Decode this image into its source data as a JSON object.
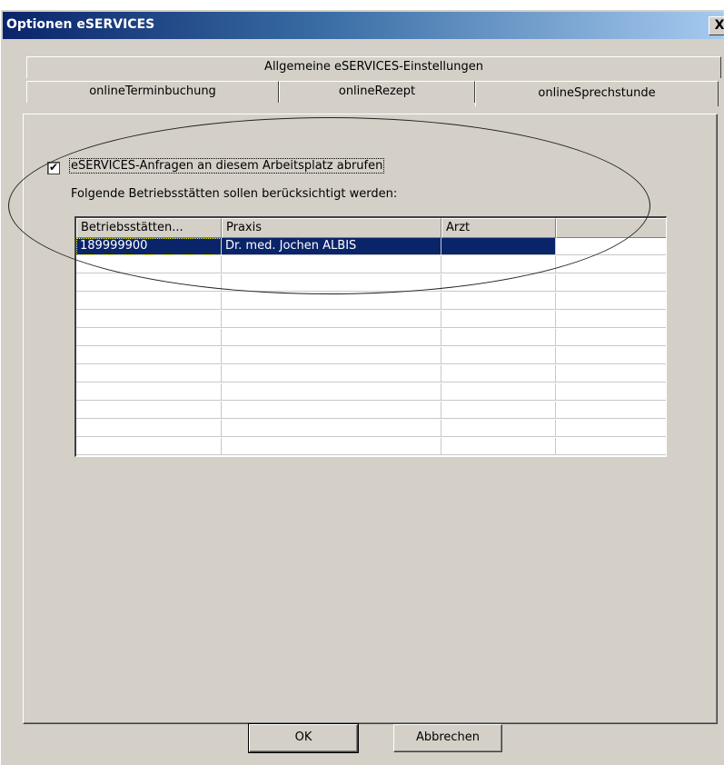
{
  "dialog": {
    "title": "Optionen eSERVICES",
    "close_label": "X"
  },
  "tabs": {
    "row_top": [
      {
        "label": "Allgemeine eSERVICES-Einstellungen"
      }
    ],
    "row_bottom": [
      {
        "label": "onlineTerminbuchung"
      },
      {
        "label": "onlineRezept"
      },
      {
        "label": "onlineSprechstunde",
        "active": true
      }
    ]
  },
  "panel": {
    "checkbox_checked": true,
    "checkbox_mark": "✔",
    "checkbox_label": "eSERVICES-Anfragen an diesem Arbeitsplatz abrufen",
    "sub_label": "Folgende  Betriebsstätten sollen berücksichtigt werden:"
  },
  "grid": {
    "columns": [
      "Betriebsstätten...",
      "Praxis",
      "Arzt",
      ""
    ],
    "rows": [
      {
        "bsnr": "189999900",
        "praxis": "Dr. med. Jochen ALBIS",
        "arzt": "",
        "selected": true
      }
    ],
    "empty_rows": 11
  },
  "buttons": {
    "ok": "OK",
    "cancel": "Abbrechen"
  },
  "colors": {
    "face": "#d4d0c8",
    "selection": "#0a246a",
    "title_start": "#0a246a",
    "title_end": "#a6caf0"
  }
}
